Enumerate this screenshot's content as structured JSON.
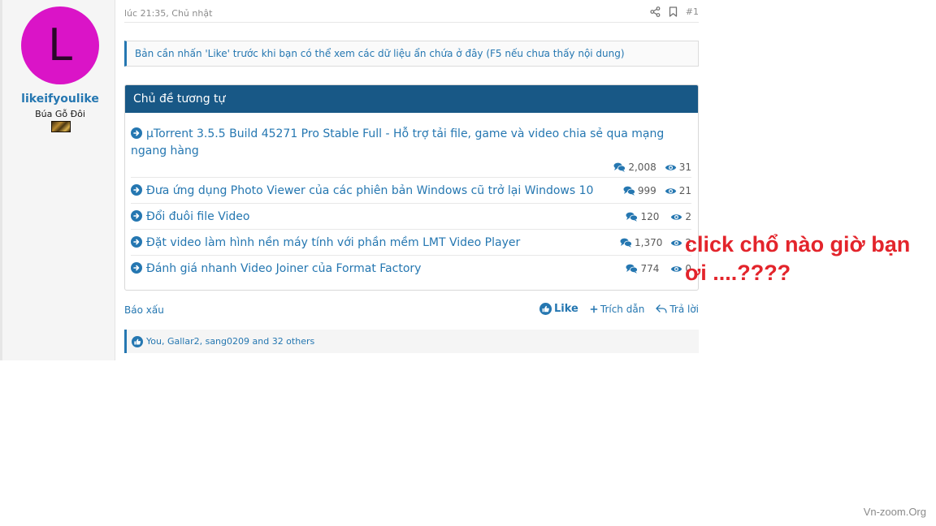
{
  "user": {
    "avatar_letter": "L",
    "avatar_color": "#da14c7",
    "name": "likeifyoulike",
    "title": "Búa Gỗ Đôi"
  },
  "post": {
    "date": "lúc 21:35, Chủ nhật",
    "number": "#1",
    "header_icons": [
      "share-icon",
      "bookmark-icon"
    ],
    "hidden_notice": "Bản cần nhấn 'Like' trước khi bạn có thể xem các dữ liệu ẩn chứa ở đây (F5 nếu chưa thấy nội dung)"
  },
  "similar": {
    "heading": "Chủ đề tương tự",
    "threads": [
      {
        "title": "µTorrent 3.5.5 Build 45271 Pro Stable Full - Hỗ trợ tải file, game và video chia sẻ qua mạng ngang hàng",
        "replies": "2,008",
        "views": "31"
      },
      {
        "title": "Đưa ứng dụng Photo Viewer của các phiên bản Windows cũ trở lại Windows 10",
        "replies": "999",
        "views": "21"
      },
      {
        "title": "Đổi đuôi file Video",
        "replies": "120",
        "views": "2"
      },
      {
        "title": "Đặt video làm hình nền máy tính với phần mềm LMT Video Player",
        "replies": "1,370",
        "views": "2"
      },
      {
        "title": "Đánh giá nhanh Video Joiner của Format Factory",
        "replies": "774",
        "views": "0"
      }
    ]
  },
  "actions": {
    "report": "Báo xấu",
    "like": "Like",
    "quote": "Trích dẫn",
    "reply": "Trả lời"
  },
  "reactions": {
    "text": "You, Gallar2, sang0209 and 32 others"
  },
  "annotation": {
    "line1": "click chổ nào giờ bạn",
    "line2": "ơi ....????",
    "color": "#e3242b"
  },
  "watermark": "Vn-zoom.Org",
  "colors": {
    "accent": "#2577b1",
    "header_bg": "#185886"
  }
}
